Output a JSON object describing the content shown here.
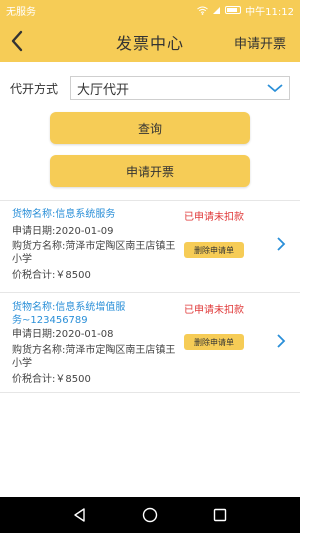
{
  "status_bar": {
    "carrier": "无服务",
    "time": "中午11:12"
  },
  "header": {
    "title": "发票中心",
    "action": "申请开票"
  },
  "filter": {
    "label": "代开方式",
    "selected": "大厅代开"
  },
  "buttons": {
    "query": "查询",
    "apply": "申请开票"
  },
  "invoices": [
    {
      "goods_name": "货物名称:信息系统服务",
      "goods_name_cont": "",
      "status": "已申请未扣款",
      "date": "申请日期:2020-01-09",
      "buyer": "购货方名称:菏泽市定陶区南王店镇王",
      "buyer_cont": "小学",
      "total": "价税合计:￥8500",
      "delete_label": "删除申请单"
    },
    {
      "goods_name": "货物名称:信息系统增值服",
      "goods_name_cont": "务~123456789",
      "status": "已申请未扣款",
      "date": "申请日期:2020-01-08",
      "buyer": "购货方名称:菏泽市定陶区南王店镇王",
      "buyer_cont": "小学",
      "total": "价税合计:￥8500",
      "delete_label": "删除申请单"
    }
  ],
  "colors": {
    "accent": "#f6cc56",
    "link": "#2a8fd8",
    "alert": "#e03a3a"
  }
}
